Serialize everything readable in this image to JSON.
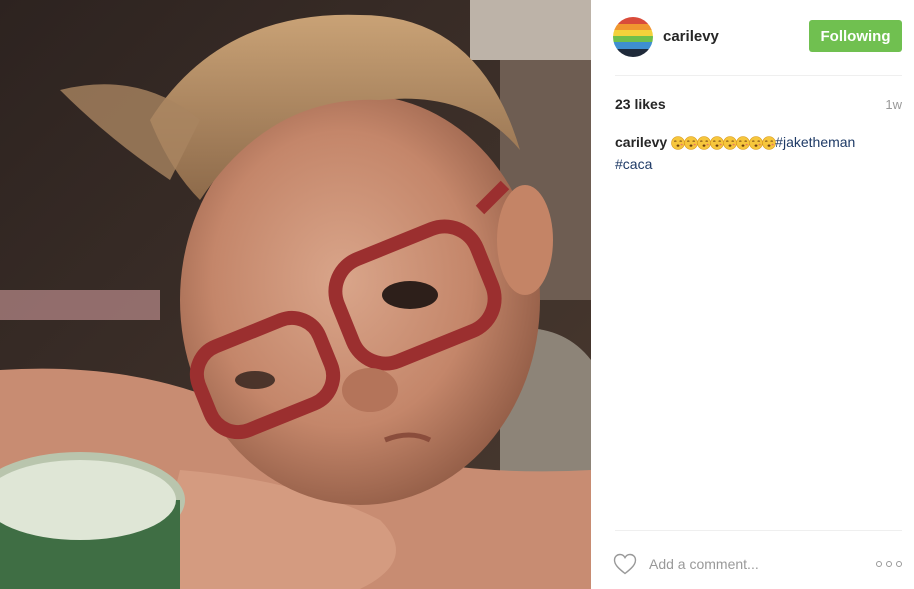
{
  "post": {
    "photo_icon": "photo-of-child-with-red-glasses",
    "header": {
      "avatar_icon": "profile-avatar-rainbow",
      "username": "carilevy",
      "follow_label": "Following",
      "follow_color": "#70c050"
    },
    "likes": "23 likes",
    "time": "1w",
    "caption": {
      "username": "carilevy",
      "emoji_icon": "kissing-face-emoji",
      "emoji_count": 8,
      "hashtags": [
        "#jaketheman",
        "#caca"
      ]
    },
    "footer": {
      "like_icon": "heart-icon",
      "comment_placeholder": "Add a comment...",
      "more_icon": "more-options-icon"
    }
  }
}
